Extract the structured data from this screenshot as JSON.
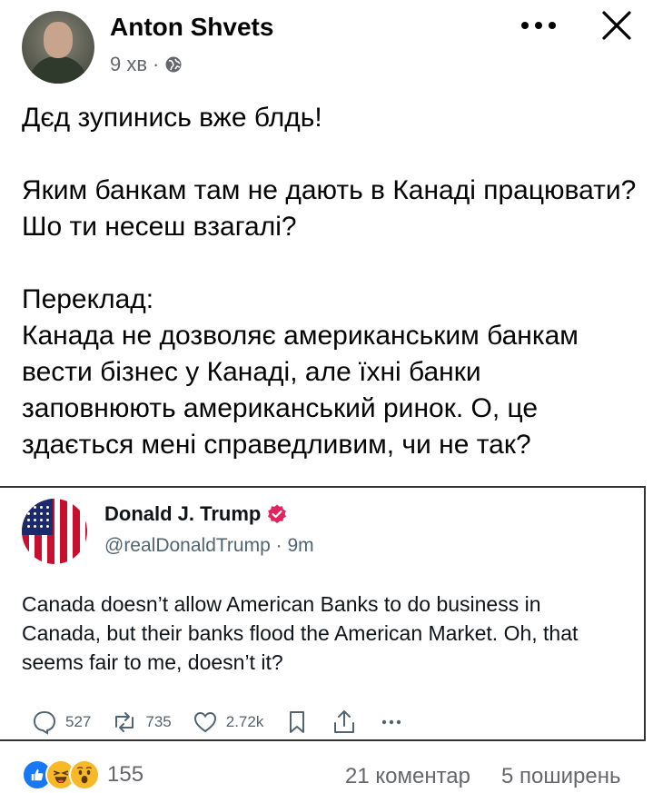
{
  "post": {
    "author": "Anton Shvets",
    "time": "9 хв",
    "separator": "·",
    "text": "Дєд зупинись вже блдь!\n\nЯким банкам там не дають в Канаді працювати? Шо ти несеш взагалі?\n\nПереклад:\nКанада не дозволяє американським банкам вести бізнес у Канаді, але їхні банки заповнюють американський ринок. О, це здається мені справедливим, чи не так?"
  },
  "tweet": {
    "name": "Donald J. Trump",
    "handle": "@realDonaldTrump · 9m",
    "text": "Canada doesn’t allow American Banks to do business in Canada, but their banks flood the American Market. Oh, that seems fair to me, doesn’t it?",
    "replies": "527",
    "retweets": "735",
    "likes": "2.72k"
  },
  "footer": {
    "reactions_count": "155",
    "comments": "21 коментар",
    "shares": "5 поширень"
  },
  "colors": {
    "verified": "#e0245e",
    "like_blue": "#1877f2",
    "meta_gray": "#65676b"
  },
  "icons": [
    "globe-icon",
    "more-icon",
    "close-icon",
    "verified-icon",
    "reply-icon",
    "retweet-icon",
    "like-icon",
    "bookmark-icon",
    "share-icon",
    "more-horizontal-icon",
    "like-reaction-icon",
    "haha-reaction-icon",
    "wow-reaction-icon"
  ]
}
